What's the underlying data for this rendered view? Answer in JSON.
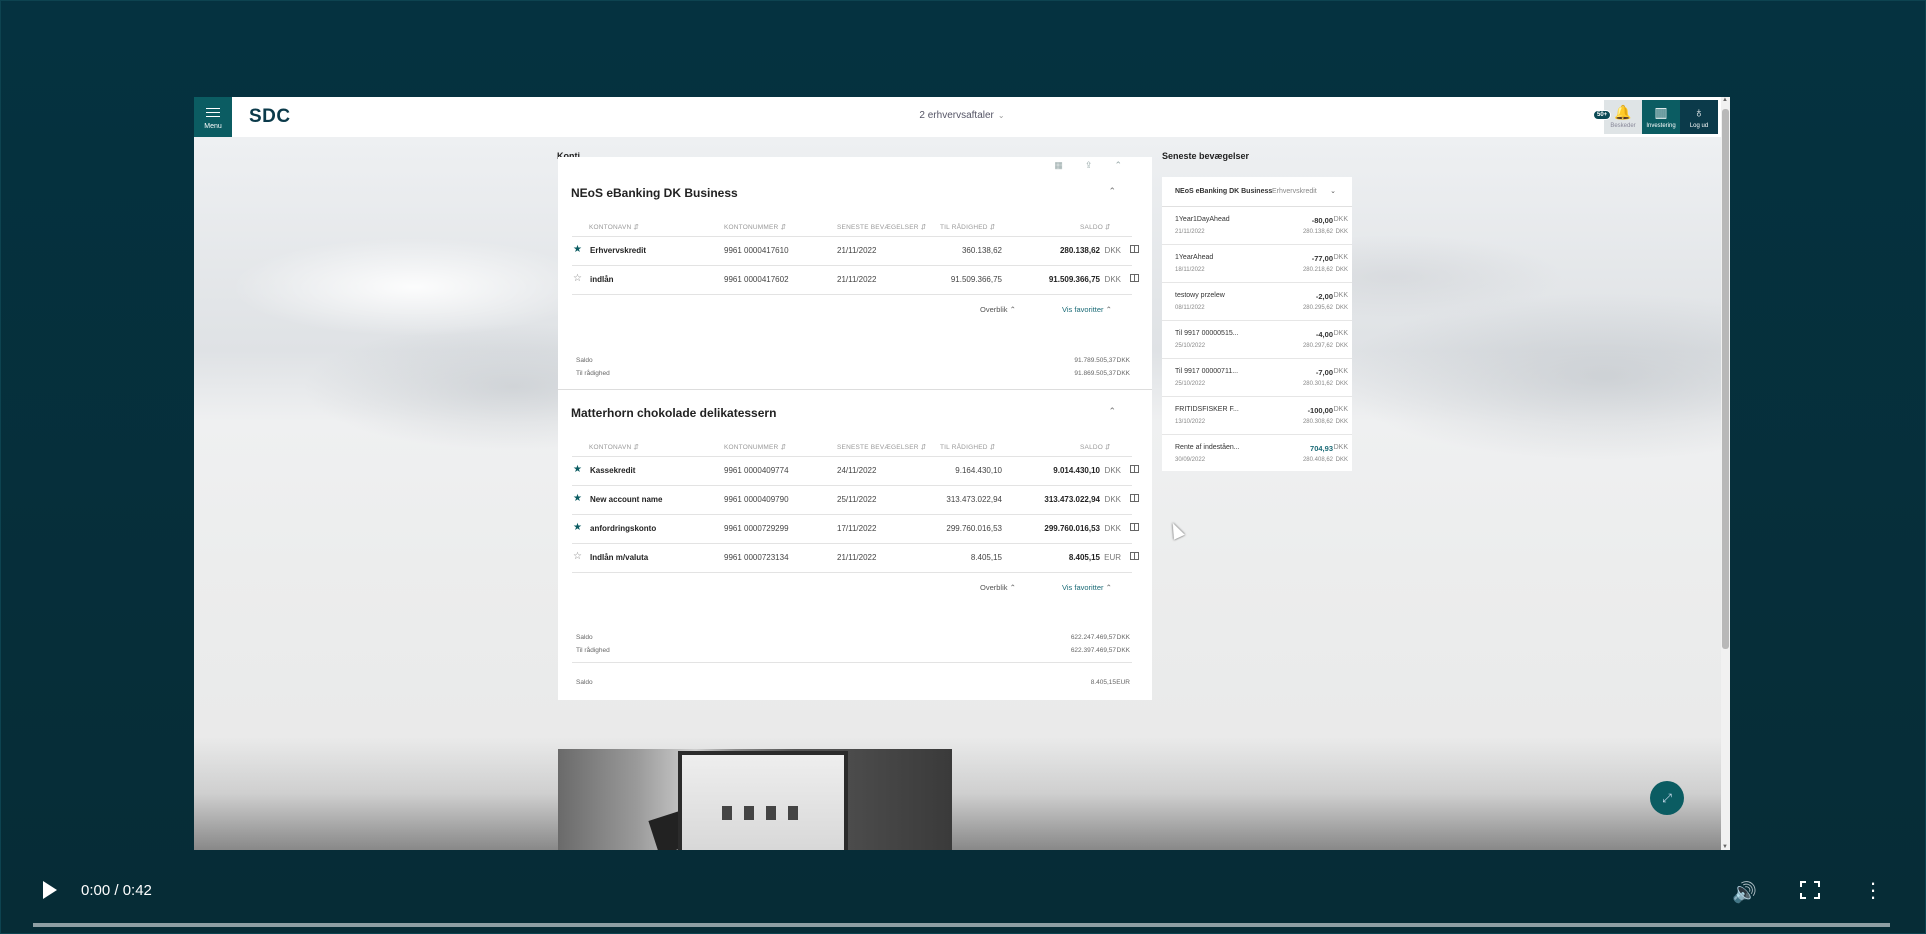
{
  "app": {
    "menu_label": "Menu",
    "logo": "SDC",
    "agreement": "2 erhvervsaftaler",
    "top_right": {
      "badge": "50+",
      "notifications_label": "Beskeder",
      "investing_label": "Investering",
      "logout_label": "Log ud"
    }
  },
  "konti": {
    "title": "Konti",
    "sections": [
      {
        "title": "NEoS eBanking DK Business",
        "headers": [
          "KONTONAVN",
          "KONTONUMMER",
          "SENESTE BEVÆGELSER",
          "TIL RÅDIGHED",
          "SALDO"
        ],
        "rows": [
          {
            "fav": true,
            "name": "Erhvervskredit",
            "number": "9961 0000417610",
            "date": "21/11/2022",
            "available": "360.138,62",
            "balance": "280.138,62",
            "cur": "DKK"
          },
          {
            "fav": false,
            "name": "indlån",
            "number": "9961 0000417602",
            "date": "21/11/2022",
            "available": "91.509.366,75",
            "balance": "91.509.366,75",
            "cur": "DKK"
          }
        ],
        "overview_label": "Overblik",
        "favorites_label": "Vis favoritter",
        "totals": [
          {
            "label": "Saldo",
            "value": "91.789.505,37",
            "cur": "DKK"
          },
          {
            "label": "Til rådighed",
            "value": "91.869.505,37",
            "cur": "DKK"
          }
        ]
      },
      {
        "title": "Matterhorn chokolade delikatessern",
        "headers": [
          "KONTONAVN",
          "KONTONUMMER",
          "SENESTE BEVÆGELSER",
          "TIL RÅDIGHED",
          "SALDO"
        ],
        "rows": [
          {
            "fav": true,
            "name": "Kassekredit",
            "number": "9961 0000409774",
            "date": "24/11/2022",
            "available": "9.164.430,10",
            "balance": "9.014.430,10",
            "cur": "DKK"
          },
          {
            "fav": true,
            "name": "New account name",
            "number": "9961 0000409790",
            "date": "25/11/2022",
            "available": "313.473.022,94",
            "balance": "313.473.022,94",
            "cur": "DKK"
          },
          {
            "fav": true,
            "name": "anfordringskonto",
            "number": "9961 0000729299",
            "date": "17/11/2022",
            "available": "299.760.016,53",
            "balance": "299.760.016,53",
            "cur": "DKK"
          },
          {
            "fav": false,
            "name": "Indlån m/valuta",
            "number": "9961 0000723134",
            "date": "21/11/2022",
            "available": "8.405,15",
            "balance": "8.405,15",
            "cur": "EUR"
          }
        ],
        "overview_label": "Overblik",
        "favorites_label": "Vis favoritter",
        "totals": [
          {
            "label": "Saldo",
            "value": "622.247.469,57",
            "cur": "DKK"
          },
          {
            "label": "Til rådighed",
            "value": "622.397.469,57",
            "cur": "DKK"
          },
          {
            "label": "Saldo",
            "value": "8.405,15",
            "cur": "EUR"
          }
        ]
      }
    ]
  },
  "movements": {
    "title": "Seneste bevægelser",
    "filter_agreement": "NEoS eBanking DK Business",
    "filter_account": "Erhvervskredit",
    "items": [
      {
        "name": "1Year1DayAhead",
        "date": "21/11/2022",
        "amount": "-80,00",
        "cur": "DKK",
        "balance": "280.138,62"
      },
      {
        "name": "1YearAhead",
        "date": "18/11/2022",
        "amount": "-77,00",
        "cur": "DKK",
        "balance": "280.218,62"
      },
      {
        "name": "testowy przelew",
        "date": "08/11/2022",
        "amount": "-2,00",
        "cur": "DKK",
        "balance": "280.295,62"
      },
      {
        "name": "Til 9917 00000515...",
        "date": "25/10/2022",
        "amount": "-4,00",
        "cur": "DKK",
        "balance": "280.297,62"
      },
      {
        "name": "Til 9917 00000711...",
        "date": "25/10/2022",
        "amount": "-7,00",
        "cur": "DKK",
        "balance": "280.301,62"
      },
      {
        "name": "FRITIDSFISKER F...",
        "date": "13/10/2022",
        "amount": "-100,00",
        "cur": "DKK",
        "balance": "280.308,62"
      },
      {
        "name": "Rente af indeståen...",
        "date": "30/09/2022",
        "amount": "704,93",
        "cur": "DKK",
        "balance": "280.408,62"
      }
    ]
  },
  "video": {
    "time": "0:00 / 0:42",
    "progress": 0
  }
}
